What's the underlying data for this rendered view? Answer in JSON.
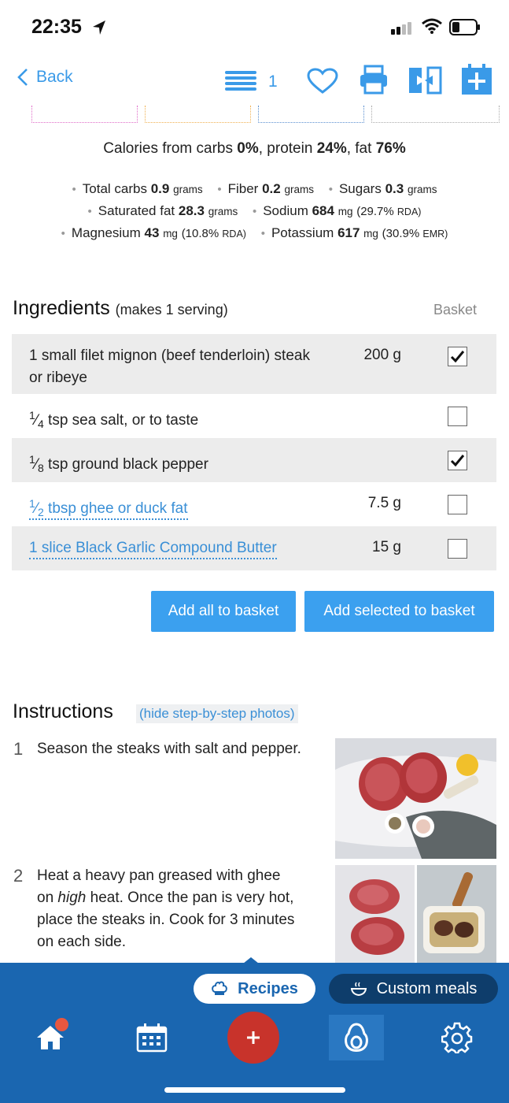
{
  "status": {
    "time": "22:35"
  },
  "toolbar": {
    "back_label": "Back",
    "servings": "1"
  },
  "summary": {
    "prefix": "Calories from carbs ",
    "carbs": "0%",
    "sep1": ", protein ",
    "protein": "24%",
    "sep2": ", fat ",
    "fat": "76%"
  },
  "nutrients": [
    {
      "label": "Total carbs",
      "value": "0.9",
      "unit": "grams"
    },
    {
      "label": "Fiber",
      "value": "0.2",
      "unit": "grams"
    },
    {
      "label": "Sugars",
      "value": "0.3",
      "unit": "grams"
    },
    {
      "label": "Saturated fat",
      "value": "28.3",
      "unit": "grams"
    },
    {
      "label": "Sodium",
      "value": "684",
      "unit": "mg",
      "rda_pct": "(29.7%",
      "rda_label": "RDA)"
    },
    {
      "label": "Magnesium",
      "value": "43",
      "unit": "mg",
      "rda_pct": "(10.8%",
      "rda_label": "RDA)"
    },
    {
      "label": "Potassium",
      "value": "617",
      "unit": "mg",
      "rda_pct": "(30.9%",
      "rda_label": "EMR)"
    }
  ],
  "ingredients": {
    "title": "Ingredients",
    "subtitle": "(makes 1 serving)",
    "basket_header": "Basket",
    "rows": [
      {
        "text_line1": "1 small filet mignon (beef tenderloin) steak",
        "text_line2": "or ribeye",
        "amount": "200 g",
        "checked": true
      },
      {
        "frac_num": "1",
        "frac_den": "4",
        "text": " tsp sea salt, or to taste",
        "amount": "",
        "checked": false
      },
      {
        "frac_num": "1",
        "frac_den": "8",
        "text": " tsp ground black pepper",
        "amount": "",
        "checked": true
      },
      {
        "frac_num": "1",
        "frac_den": "2",
        "text": " tbsp ghee or duck fat",
        "amount": "7.5 g",
        "checked": false,
        "link": true
      },
      {
        "text": "1 slice Black Garlic Compound Butter",
        "amount": "15 g",
        "checked": false,
        "link": true
      }
    ],
    "add_all_label": "Add all to basket",
    "add_selected_label": "Add selected to basket"
  },
  "instructions": {
    "title": "Instructions",
    "toggle_label": "(hide step-by-step photos)",
    "steps": [
      {
        "num": "1",
        "line1": "Season the steaks with salt and pepper."
      },
      {
        "num": "2",
        "line1_pre": "Heat a heavy pan greased with ghee",
        "line2_pre": "on ",
        "line2_em": "high",
        "line2_post": " heat. Once the pan is very hot,",
        "line3": "place the steaks in. Cook for 3 minutes",
        "line4": "on each side."
      }
    ]
  },
  "modes": {
    "recipes_label": "Recipes",
    "custom_label": "Custom meals"
  },
  "colors": {
    "accent": "#3ba0ef",
    "nav": "#1a66b0",
    "fab": "#c8332b",
    "link": "#3a8fd6"
  }
}
